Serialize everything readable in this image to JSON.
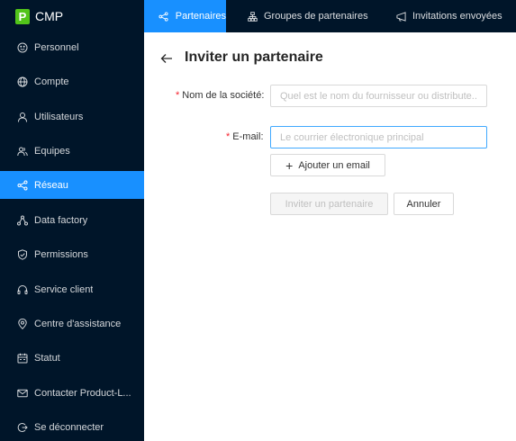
{
  "brand": {
    "logo_letter": "P",
    "name": "CMP"
  },
  "sidebar": {
    "items": [
      {
        "label": "Personnel",
        "icon": "smile-icon"
      },
      {
        "label": "Compte",
        "icon": "globe-icon"
      },
      {
        "label": "Utilisateurs",
        "icon": "user-icon"
      },
      {
        "label": "Equipes",
        "icon": "team-icon"
      },
      {
        "label": "Réseau",
        "icon": "share-icon",
        "active": true
      },
      {
        "label": "Data factory",
        "icon": "cluster-icon"
      },
      {
        "label": "Permissions",
        "icon": "shield-icon"
      },
      {
        "label": "Service client",
        "icon": "headset-icon"
      },
      {
        "label": "Centre d'assistance",
        "icon": "location-icon"
      },
      {
        "label": "Statut",
        "icon": "calendar-icon"
      },
      {
        "label": "Contacter Product-L...",
        "icon": "mail-icon"
      },
      {
        "label": "Se déconnecter",
        "icon": "logout-icon"
      }
    ]
  },
  "tabs": [
    {
      "label": "Partenaires",
      "icon": "share-icon",
      "active": true
    },
    {
      "label": "Groupes de partenaires",
      "icon": "org-icon"
    },
    {
      "label": "Invitations envoyées",
      "icon": "send-icon"
    }
  ],
  "page": {
    "title": "Inviter un partenaire"
  },
  "form": {
    "required_mark": "*",
    "company_label": "Nom de la société",
    "company_placeholder": "Quel est le nom du fournisseur ou distribute...",
    "email_label": "E-mail",
    "email_placeholder": "Le courrier électronique principal",
    "add_email_label": "Ajouter un email",
    "invite_label": "Inviter un partenaire",
    "cancel_label": "Annuler"
  },
  "colors": {
    "sidebar_bg": "#001529",
    "accent": "#1890ff",
    "logo": "#52c41a",
    "required": "#f5222d"
  }
}
